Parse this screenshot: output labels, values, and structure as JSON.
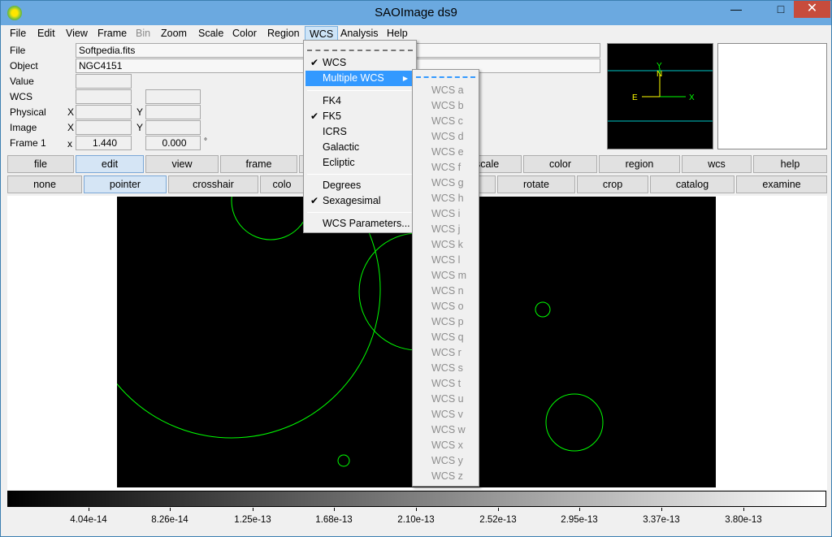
{
  "window": {
    "title": "SAOImage ds9",
    "min_label": "—",
    "max_label": "□",
    "close_label": "✕"
  },
  "menubar": [
    "File",
    "Edit",
    "View",
    "Frame",
    "Bin",
    "Zoom",
    "Scale",
    "Color",
    "Region",
    "WCS",
    "Analysis",
    "Help"
  ],
  "info": {
    "file_label": "File",
    "file_value": "Softpedia.fits",
    "object_label": "Object",
    "object_value": "NGC4151",
    "value_label": "Value",
    "wcs_label": "WCS",
    "physical_label": "Physical",
    "image_label": "Image",
    "frame_label": "Frame 1",
    "x_label": "X",
    "y_label": "Y",
    "x_small": "x",
    "zoom_value": "1.440",
    "angle_value": "0.000",
    "angle_unit": "°"
  },
  "panner": {
    "n_label": "N",
    "e_label": "E",
    "x_label": "X",
    "y_label": "Y"
  },
  "button_row_1": [
    "file",
    "edit",
    "view",
    "frame",
    "scale",
    "color",
    "region",
    "wcs",
    "help"
  ],
  "button_row_2": [
    "none",
    "pointer",
    "crosshair",
    "colorbar",
    "rotate",
    "crop",
    "catalog",
    "examine"
  ],
  "button_row_2_partial": "colo",
  "colorbar_labels": [
    "4.04e-14",
    "8.26e-14",
    "1.25e-13",
    "1.68e-13",
    "2.10e-13",
    "2.52e-13",
    "2.95e-13",
    "3.37e-13",
    "3.80e-13"
  ],
  "wcs_menu": {
    "items": [
      "WCS",
      "Multiple WCS",
      "FK4",
      "FK5",
      "ICRS",
      "Galactic",
      "Ecliptic",
      "Degrees",
      "Sexagesimal",
      "WCS Parameters..."
    ],
    "checked": [
      "WCS",
      "FK5",
      "Sexagesimal"
    ],
    "highlighted": "Multiple WCS"
  },
  "multiple_wcs_menu": [
    "WCS a",
    "WCS b",
    "WCS c",
    "WCS d",
    "WCS e",
    "WCS f",
    "WCS g",
    "WCS h",
    "WCS i",
    "WCS j",
    "WCS k",
    "WCS l",
    "WCS m",
    "WCS n",
    "WCS o",
    "WCS p",
    "WCS q",
    "WCS r",
    "WCS s",
    "WCS t",
    "WCS u",
    "WCS v",
    "WCS w",
    "WCS x",
    "WCS y",
    "WCS z"
  ],
  "colors": {
    "region": "#00ff00",
    "panner_line": "#00c8c8",
    "compass": "#ffff00",
    "highlight": "#3399ff"
  }
}
